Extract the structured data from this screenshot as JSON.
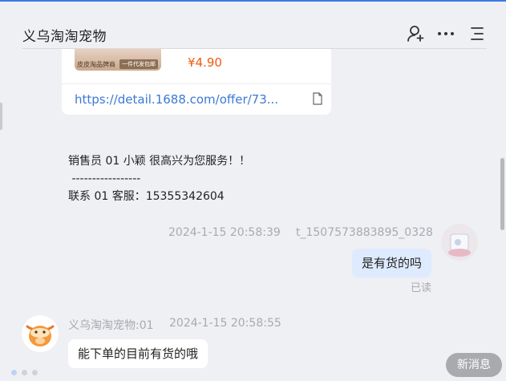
{
  "header": {
    "title": "义乌淘淘宠物",
    "icons": [
      "add-user-icon",
      "more-icon",
      "menu-icon"
    ]
  },
  "product_card": {
    "thumb_text": "皮皮淘品牌商",
    "thumb_badge": "一件代发包邮",
    "price": "¥4.90",
    "link": "https://detail.1688.com/offer/73..."
  },
  "system_message": {
    "line1": "销售员 01 小颖 很高兴为您服务！！",
    "line2": " -----------------",
    "line3": "联系 01 客服：15355342604"
  },
  "messages": [
    {
      "side": "right",
      "time": "2024-1-15 20:58:39",
      "sender": "t_1507573883895_0328",
      "text": "是有货的吗",
      "status": "已读"
    },
    {
      "side": "left",
      "sender": "义乌淘淘宠物:01",
      "time": "2024-1-15 20:58:55",
      "text": "能下单的目前有货的哦"
    }
  ],
  "new_message_button": "新消息",
  "colors": {
    "accent": "#3b78e7",
    "price": "#ef5b12",
    "link": "#3b79d6",
    "bubble_self": "#deeafe",
    "bubble_other": "#ffffff",
    "background": "#eff0f3"
  }
}
